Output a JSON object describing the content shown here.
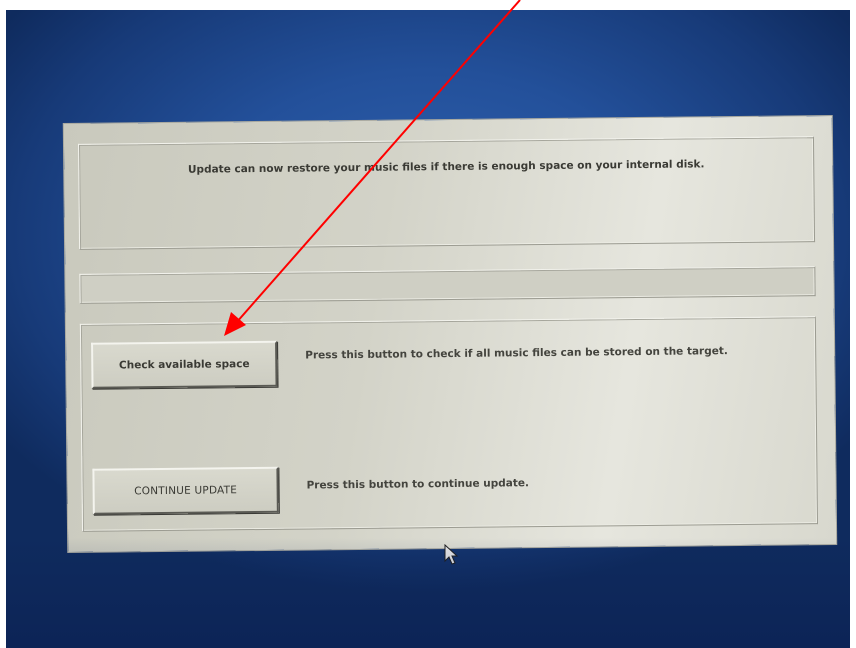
{
  "dialog": {
    "message": "Update can now restore your music files if there is enough space on your internal disk.",
    "progress": 0
  },
  "actions": {
    "check_button_label": "Check available space",
    "check_description": "Press this button to check if all music files can be stored on the target.",
    "continue_button_label": "CONTINUE UPDATE",
    "continue_description": "Press this button to continue update."
  },
  "colors": {
    "desktop": "#23509a",
    "dialog_background": "#d3d3c8",
    "text": "#3a3a34",
    "annotation_arrow": "#ff0000"
  },
  "icons": {
    "pointer": "mouse-pointer-icon",
    "annotation": "red-arrow-annotation"
  }
}
